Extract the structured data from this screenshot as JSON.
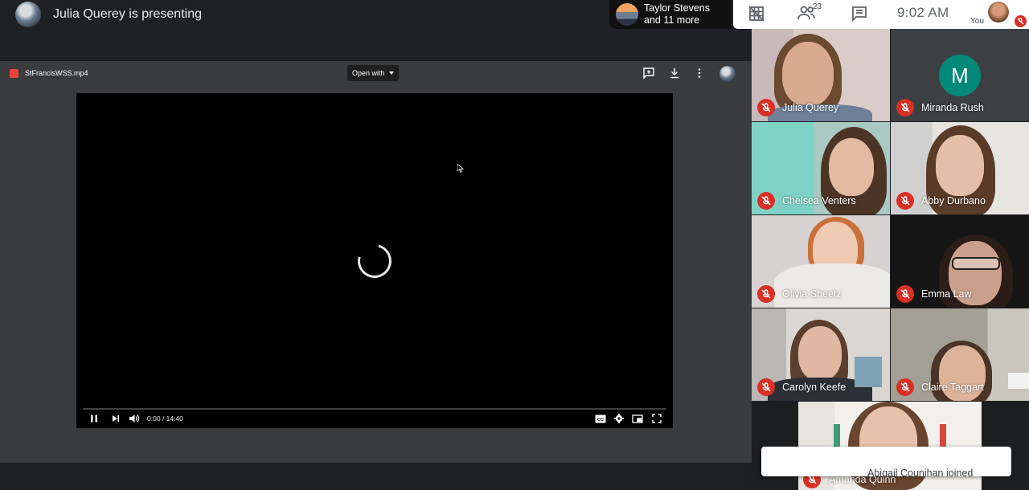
{
  "presenter": {
    "text": "Julia Querey is presenting"
  },
  "others": {
    "name": "Taylor Stevens",
    "more": "and 11 more"
  },
  "toolbar": {
    "people_count": "23",
    "time": "9:02  AM",
    "you_label": "You"
  },
  "viewer": {
    "file_name": "StFrancisWSS.mp4",
    "open_with": "Open with",
    "time": "0:00 / 14:40",
    "progress": 0
  },
  "participants": [
    {
      "name": "Julia Querey"
    },
    {
      "name": "Miranda Rush",
      "initial": "M"
    },
    {
      "name": "Chelsea Venters"
    },
    {
      "name": "Abby Durbano"
    },
    {
      "name": "Olivia Sheetz"
    },
    {
      "name": "Emma Law"
    },
    {
      "name": "Carolyn Keefe"
    },
    {
      "name": "Claire Taggart"
    },
    {
      "name": "Amanda Quinn"
    }
  ],
  "toast": {
    "text": "Abigail Counihan joined"
  },
  "colors": {
    "mic_off": "#d93025",
    "avatar_teal": "#00897b",
    "progress": "#ea4335"
  }
}
